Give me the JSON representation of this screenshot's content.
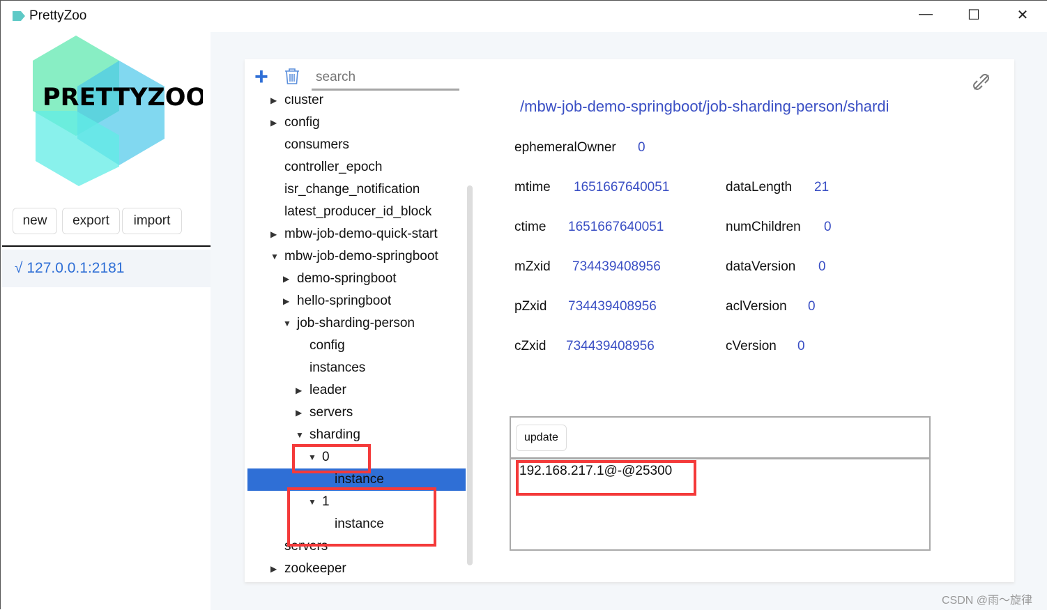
{
  "window": {
    "title": "PrettyZoo",
    "minimize": "—",
    "maximize": "☐",
    "close": "✕"
  },
  "sidebar": {
    "logo_text": "PRETTYZOO",
    "buttons": {
      "new": "new",
      "export": "export",
      "import": "import"
    },
    "server": "√ 127.0.0.1:2181"
  },
  "toolbar": {
    "search_placeholder": "search",
    "add_icon": "+",
    "delete_icon": "trash"
  },
  "tree": [
    {
      "label": "cluster",
      "level": 0,
      "expander": "right"
    },
    {
      "label": "config",
      "level": 0,
      "expander": "right"
    },
    {
      "label": "consumers",
      "level": 0,
      "expander": ""
    },
    {
      "label": "controller_epoch",
      "level": 0,
      "expander": ""
    },
    {
      "label": "isr_change_notification",
      "level": 0,
      "expander": ""
    },
    {
      "label": "latest_producer_id_block",
      "level": 0,
      "expander": ""
    },
    {
      "label": "mbw-job-demo-quick-start",
      "level": 0,
      "expander": "right"
    },
    {
      "label": "mbw-job-demo-springboot",
      "level": 0,
      "expander": "down"
    },
    {
      "label": "demo-springboot",
      "level": 1,
      "expander": "right"
    },
    {
      "label": "hello-springboot",
      "level": 1,
      "expander": "right"
    },
    {
      "label": "job-sharding-person",
      "level": 1,
      "expander": "down"
    },
    {
      "label": "config",
      "level": 2,
      "expander": ""
    },
    {
      "label": "instances",
      "level": 2,
      "expander": ""
    },
    {
      "label": "leader",
      "level": 2,
      "expander": "right"
    },
    {
      "label": "servers",
      "level": 2,
      "expander": "right"
    },
    {
      "label": "sharding",
      "level": 2,
      "expander": "down"
    },
    {
      "label": "0",
      "level": 3,
      "expander": "down"
    },
    {
      "label": "instance",
      "level": 4,
      "expander": "",
      "selected": true
    },
    {
      "label": "1",
      "level": 3,
      "expander": "down"
    },
    {
      "label": "instance",
      "level": 4,
      "expander": ""
    },
    {
      "label": "servers",
      "level": 0,
      "expander": ""
    },
    {
      "label": "zookeeper",
      "level": 0,
      "expander": "right"
    }
  ],
  "detail": {
    "path": "/mbw-job-demo-springboot/job-sharding-person/shardi",
    "ephemeralOwner": {
      "label": "ephemeralOwner",
      "value": "0"
    },
    "left": [
      {
        "label": "mtime",
        "value": "1651667640051"
      },
      {
        "label": "ctime",
        "value": "1651667640051"
      },
      {
        "label": "mZxid",
        "value": "734439408956"
      },
      {
        "label": "pZxid",
        "value": "734439408956"
      },
      {
        "label": "cZxid",
        "value": "734439408956"
      }
    ],
    "right": [
      {
        "label": "dataLength",
        "value": "21"
      },
      {
        "label": "numChildren",
        "value": "0"
      },
      {
        "label": "dataVersion",
        "value": "0"
      },
      {
        "label": "aclVersion",
        "value": "0"
      },
      {
        "label": "cVersion",
        "value": "0"
      }
    ],
    "update_label": "update",
    "data": "192.168.217.1@-@25300"
  },
  "watermark": "CSDN @雨～旋律",
  "colors": {
    "accent": "#2f6fd6",
    "value": "#3a4fc4",
    "highlight": "#f43a3a"
  }
}
